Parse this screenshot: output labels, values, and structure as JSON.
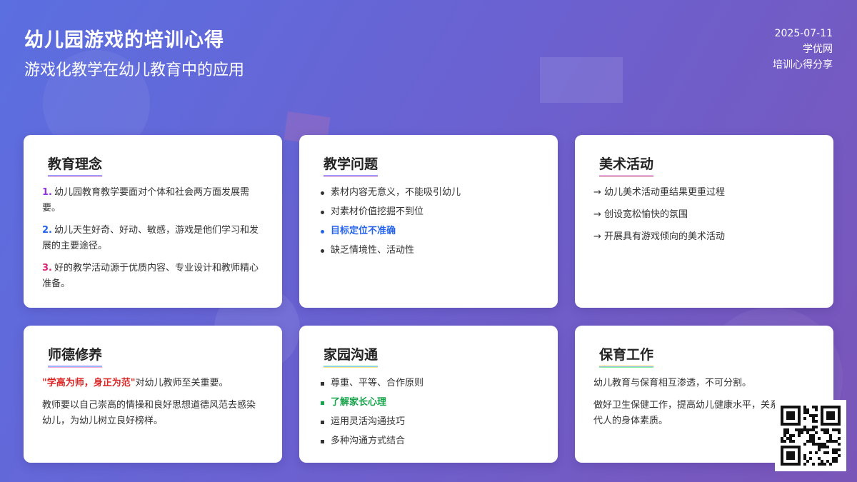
{
  "header": {
    "title": "幼儿园游戏的培训心得",
    "subtitle": "游戏化教学在幼儿教育中的应用",
    "date": "2025-07-11",
    "site": "学优网",
    "category": "培训心得分享"
  },
  "cards": {
    "philosophy": {
      "title": "教育理念",
      "items": [
        {
          "num": "1.",
          "text": "幼儿园教育教学要面对个体和社会两方面发展需要。"
        },
        {
          "num": "2.",
          "text": "幼儿天生好奇、好动、敏感，游戏是他们学习和发展的主要途径。"
        },
        {
          "num": "3.",
          "text": "好的教学活动源于优质内容、专业设计和教师精心准备。"
        }
      ]
    },
    "problems": {
      "title": "教学问题",
      "items": [
        "素材内容无意义，不能吸引幼儿",
        "对素材价值挖掘不到位",
        "目标定位不准确",
        "缺乏情境性、活动性"
      ]
    },
    "art": {
      "title": "美术活动",
      "items": [
        "→ 幼儿美术活动重结果更重过程",
        "→ 创设宽松愉快的氛围",
        "→ 开展具有游戏倾向的美术活动"
      ]
    },
    "ethics": {
      "title": "师德修养",
      "quote": "\"学高为师，身正为范\"",
      "quote_rest": "对幼儿教师至关重要。",
      "paragraph": "教师要以自己崇高的情操和良好思想道德风范去感染幼儿，为幼儿树立良好榜样。"
    },
    "communication": {
      "title": "家园沟通",
      "items": [
        "尊重、平等、合作原则",
        "了解家长心理",
        "运用灵活沟通技巧",
        "多种沟通方式结合"
      ]
    },
    "care": {
      "title": "保育工作",
      "p1": "幼儿教育与保育相互渗透，不可分割。",
      "p2": "做好卫生保健工作，提高幼儿健康水平，关系到下一代人的身体素质。"
    }
  },
  "colors": {
    "bg_start": "#5b6fe0",
    "bg_end": "#7a55b8",
    "highlight_blue": "#2563eb",
    "highlight_green": "#16a34a",
    "highlight_red": "#dc2626"
  },
  "icons": {
    "qr": "qr-code"
  }
}
